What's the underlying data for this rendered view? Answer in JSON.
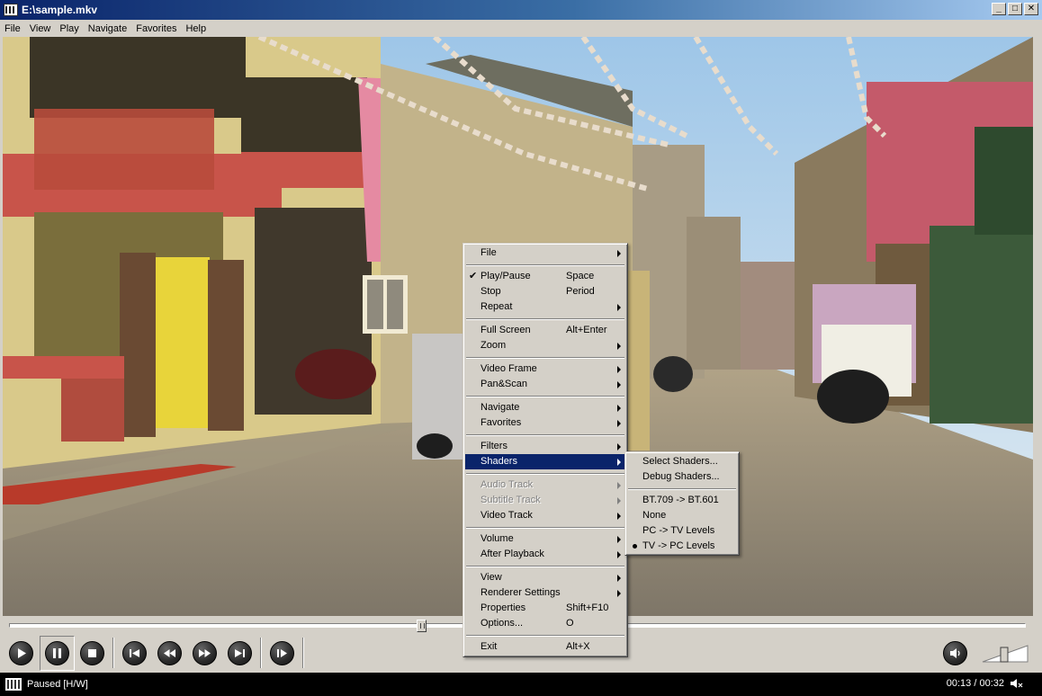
{
  "window": {
    "title": "E:\\sample.mkv",
    "minimize": "_",
    "maximize": "□",
    "close": "✕"
  },
  "menubar": [
    "File",
    "View",
    "Play",
    "Navigate",
    "Favorites",
    "Help"
  ],
  "context_menu": {
    "file": "File",
    "play_pause": "Play/Pause",
    "play_pause_shortcut": "Space",
    "stop": "Stop",
    "stop_shortcut": "Period",
    "repeat": "Repeat",
    "full_screen": "Full Screen",
    "full_screen_shortcut": "Alt+Enter",
    "zoom": "Zoom",
    "video_frame": "Video Frame",
    "pan_scan": "Pan&Scan",
    "navigate": "Navigate",
    "favorites": "Favorites",
    "filters": "Filters",
    "shaders": "Shaders",
    "audio_track": "Audio Track",
    "subtitle_track": "Subtitle Track",
    "video_track": "Video Track",
    "volume": "Volume",
    "after_playback": "After Playback",
    "view": "View",
    "renderer_settings": "Renderer Settings",
    "properties": "Properties",
    "properties_shortcut": "Shift+F10",
    "options": "Options...",
    "options_shortcut": "O",
    "exit": "Exit",
    "exit_shortcut": "Alt+X"
  },
  "shaders_submenu": {
    "select_shaders": "Select Shaders...",
    "debug_shaders": "Debug Shaders...",
    "bt709_bt601": "BT.709 -> BT.601",
    "none": "None",
    "pc_tv": "PC -> TV Levels",
    "tv_pc": "TV -> PC Levels",
    "selected": "TV -> PC Levels"
  },
  "playback": {
    "seek_position": 0.406,
    "volume_level": 0.5
  },
  "status": {
    "state": "Paused [H/W]",
    "time": "00:13 / 00:32"
  },
  "icons": {
    "play": "play-icon",
    "pause": "pause-icon",
    "stop": "stop-icon",
    "prev": "skip-previous-icon",
    "rewind": "rewind-icon",
    "forward": "fast-forward-icon",
    "next": "skip-next-icon",
    "frame_step": "frame-step-icon",
    "mute": "speaker-icon"
  },
  "colors": {
    "title_gradient_start": "#0a246a",
    "menu_highlight": "#0a246a",
    "status_bg": "#000000"
  }
}
